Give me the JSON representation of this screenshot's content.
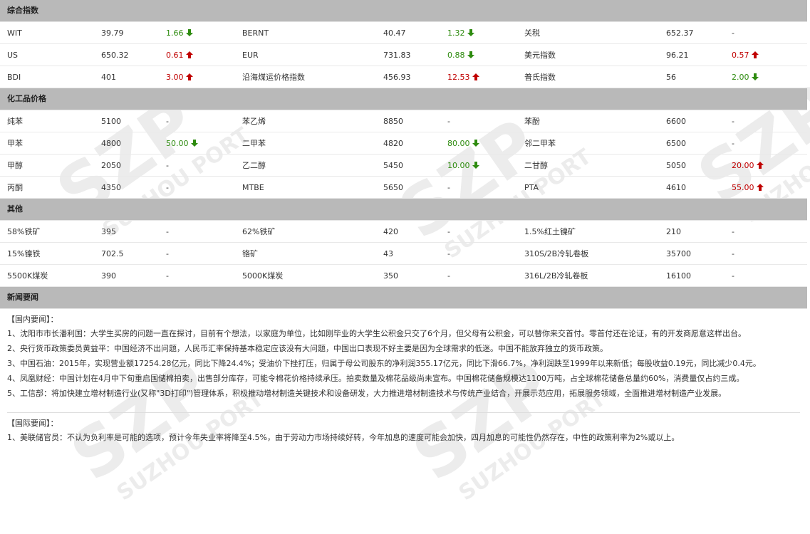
{
  "sections": {
    "index": "综合指数",
    "chem": "化工品价格",
    "other": "其他",
    "news": "新闻要闻"
  },
  "index_rows": [
    [
      {
        "n": "WIT",
        "v": "39.79",
        "c": "1.66",
        "d": "down"
      },
      {
        "n": "BERNT",
        "v": "40.47",
        "c": "1.32",
        "d": "down"
      },
      {
        "n": "关税",
        "v": "652.37",
        "c": "-",
        "d": "flat"
      }
    ],
    [
      {
        "n": "US",
        "v": "650.32",
        "c": "0.61",
        "d": "up"
      },
      {
        "n": "EUR",
        "v": "731.83",
        "c": "0.88",
        "d": "down"
      },
      {
        "n": "美元指数",
        "v": "96.21",
        "c": "0.57",
        "d": "up"
      }
    ],
    [
      {
        "n": "BDI",
        "v": "401",
        "c": "3.00",
        "d": "up"
      },
      {
        "n": "沿海煤运价格指数",
        "v": "456.93",
        "c": "12.53",
        "d": "up"
      },
      {
        "n": "普氏指数",
        "v": "56",
        "c": "2.00",
        "d": "down"
      }
    ]
  ],
  "chem_rows": [
    [
      {
        "n": "纯苯",
        "v": "5100",
        "c": "-",
        "d": "flat"
      },
      {
        "n": "苯乙烯",
        "v": "8850",
        "c": "-",
        "d": "flat"
      },
      {
        "n": "苯酚",
        "v": "6600",
        "c": "-",
        "d": "flat"
      }
    ],
    [
      {
        "n": "甲苯",
        "v": "4800",
        "c": "50.00",
        "d": "down"
      },
      {
        "n": "二甲苯",
        "v": "4820",
        "c": "80.00",
        "d": "down"
      },
      {
        "n": "邻二甲苯",
        "v": "6500",
        "c": "-",
        "d": "flat"
      }
    ],
    [
      {
        "n": "甲醇",
        "v": "2050",
        "c": "-",
        "d": "flat"
      },
      {
        "n": "乙二醇",
        "v": "5450",
        "c": "10.00",
        "d": "down"
      },
      {
        "n": "二甘醇",
        "v": "5050",
        "c": "20.00",
        "d": "up"
      }
    ],
    [
      {
        "n": "丙酮",
        "v": "4350",
        "c": "-",
        "d": "flat"
      },
      {
        "n": "MTBE",
        "v": "5650",
        "c": "-",
        "d": "flat"
      },
      {
        "n": "PTA",
        "v": "4610",
        "c": "55.00",
        "d": "up"
      }
    ]
  ],
  "other_rows": [
    [
      {
        "n": "58%铁矿",
        "v": "395",
        "c": "-",
        "d": "flat"
      },
      {
        "n": "62%铁矿",
        "v": "420",
        "c": "-",
        "d": "flat"
      },
      {
        "n": "1.5%红土镍矿",
        "v": "210",
        "c": "-",
        "d": "flat"
      }
    ],
    [
      {
        "n": "15%镍铁",
        "v": "702.5",
        "c": "-",
        "d": "flat"
      },
      {
        "n": "铬矿",
        "v": "43",
        "c": "-",
        "d": "flat"
      },
      {
        "n": "310S/2B冷轧卷板",
        "v": "35700",
        "c": "-",
        "d": "flat"
      }
    ],
    [
      {
        "n": "5500K煤炭",
        "v": "390",
        "c": "-",
        "d": "flat"
      },
      {
        "n": "5000K煤炭",
        "v": "350",
        "c": "-",
        "d": "flat"
      },
      {
        "n": "316L/2B冷轧卷板",
        "v": "16100",
        "c": "-",
        "d": "flat"
      }
    ]
  ],
  "news": {
    "domestic_header": "【国内要闻】：",
    "domestic": [
      "1、沈阳市市长潘利国：大学生买房的问题一直在探讨，目前有个想法，以家庭为单位，比如刚毕业的大学生公积金只交了6个月，但父母有公积金，可以替你来交首付。零首付还在论证，有的开发商愿意这样出台。",
      "2、央行货币政策委员黄益平：中国经济不出问题，人民币汇率保持基本稳定应该没有大问题，中国出口表现不好主要是因为全球需求的低迷。中国不能放弃独立的货币政策。",
      "3、中国石油：2015年，实现营业额17254.28亿元，同比下降24.4%；受油价下挫打压，归属于母公司股东的净利润355.17亿元，同比下滑66.7%，净利润跌至1999年以来新低；每股收益0.19元，同比减少0.4元。",
      "4、凤凰财经：中国计划在4月中下旬重启国储棉拍卖，出售部分库存，可能令棉花价格持续承压。拍卖数量及棉花品级尚未宣布。中国棉花储备规模达1100万吨，占全球棉花储备总量约60%，消费量仅占约三成。",
      "5、工信部：将加快建立增材制造行业(又称\"3D打印\")管理体系，积极推动增材制造关键技术和设备研发，大力推进增材制造技术与传统产业结合，开展示范应用，拓展服务领域，全面推进增材制造产业发展。"
    ],
    "intl_header": "【国际要闻】：",
    "intl": [
      "1、美联储官员：不认为负利率是可能的选项，预计今年失业率将降至4.5%，由于劳动力市场持续好转，今年加息的速度可能会加快，四月加息的可能性仍然存在，中性的政策利率为2%或以上。"
    ]
  },
  "watermark": "SUZHOU PORT",
  "colors": {
    "up": "#c00000",
    "down": "#2e8b0f",
    "section_bg": "#b9b9b9"
  }
}
